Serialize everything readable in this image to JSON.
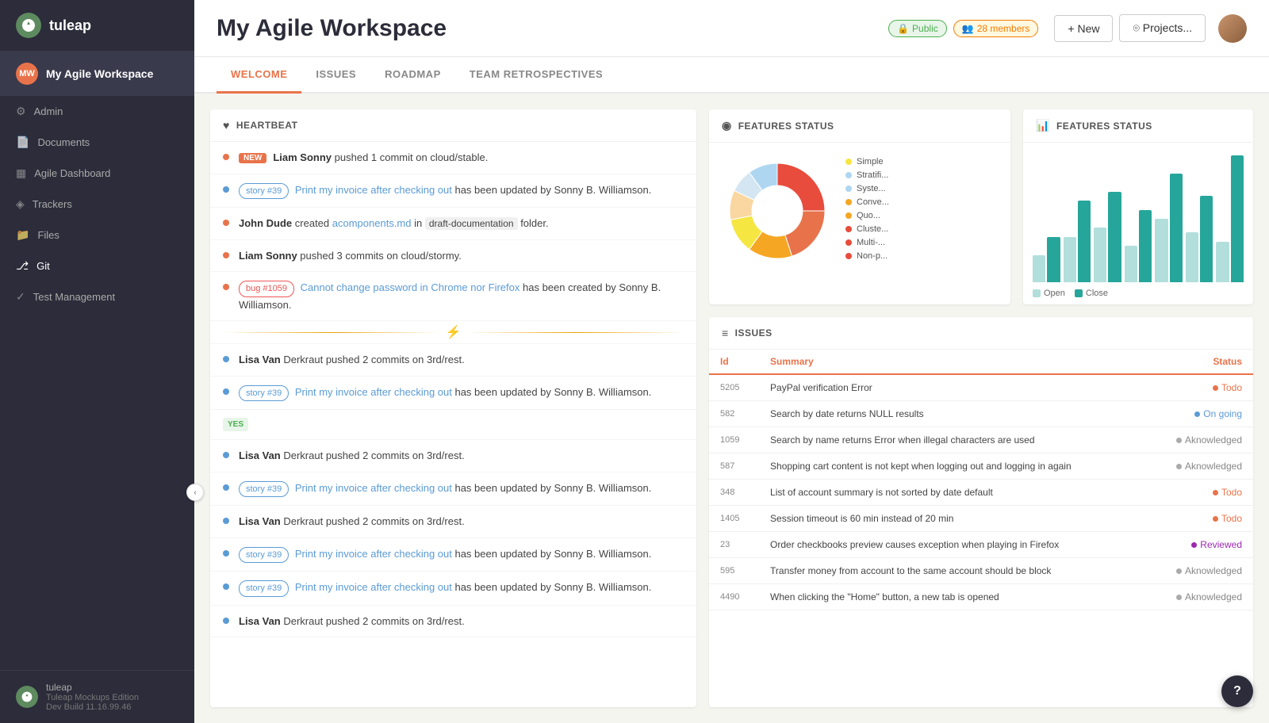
{
  "sidebar": {
    "logo": "tuleap",
    "workspace_name": "My Agile Workspace",
    "nav_items": [
      {
        "id": "admin",
        "label": "Admin",
        "icon": "⚙"
      },
      {
        "id": "documents",
        "label": "Documents",
        "icon": "📄"
      },
      {
        "id": "agile",
        "label": "Agile Dashboard",
        "icon": "⬜"
      },
      {
        "id": "trackers",
        "label": "Trackers",
        "icon": "◈"
      },
      {
        "id": "files",
        "label": "Files",
        "icon": "📁"
      },
      {
        "id": "git",
        "label": "Git",
        "icon": "⎇"
      },
      {
        "id": "test",
        "label": "Test Management",
        "icon": "✓"
      }
    ],
    "footer_app": "tuleap",
    "footer_edition": "Tuleap Mockups Edition",
    "footer_build": "Dev Build 11.16.99.46"
  },
  "header": {
    "title": "My Agile Workspace",
    "badge_public": "Public",
    "badge_members": "28 members",
    "btn_new": "+ New",
    "btn_projects": "⌾ Projects..."
  },
  "tabs": [
    {
      "id": "welcome",
      "label": "WELCOME",
      "active": true
    },
    {
      "id": "issues",
      "label": "ISSUES",
      "active": false
    },
    {
      "id": "roadmap",
      "label": "ROADMAP",
      "active": false
    },
    {
      "id": "retro",
      "label": "TEAM RETROSPECTIVES",
      "active": false
    }
  ],
  "heartbeat": {
    "title": "HEARTBEAT",
    "items": [
      {
        "type": "new_commit",
        "badge": "NEW",
        "text": "Liam Sonny pushed 1 commit on cloud/stable.",
        "dot": "orange"
      },
      {
        "type": "story",
        "story_num": "story #39",
        "text_before": "Print my invoice after checking out",
        "text_after": "has been updated by Sonny B. Williamson.",
        "dot": "blue"
      },
      {
        "type": "commit",
        "text": "John Dude created acomponents.md in draft-documentation folder.",
        "dot": "orange"
      },
      {
        "type": "commit",
        "text": "Liam Sonny pushed 3 commits on cloud/stormy.",
        "dot": "orange"
      },
      {
        "type": "bug",
        "bug_num": "bug #1059",
        "link_text": "Cannot change password in Chrome nor Firefox",
        "text_after": "has been created by Sonny B. Williamson.",
        "dot": "orange"
      },
      {
        "type": "divider"
      },
      {
        "type": "commit",
        "text": "Lisa Van Derkraut pushed 2 commits on 3rd/rest.",
        "dot": "blue"
      },
      {
        "type": "story",
        "story_num": "story #39",
        "text_before": "Print my invoice after checking out",
        "text_after": "has been updated by Sonny B. Williamson.",
        "dot": "blue"
      },
      {
        "type": "yes_divider"
      },
      {
        "type": "commit",
        "text": "Lisa Van Derkraut pushed 2 commits on 3rd/rest.",
        "dot": "blue"
      },
      {
        "type": "story",
        "story_num": "story #39",
        "text_before": "Print my invoice after checking out",
        "text_after": "has been updated by Sonny B. Williamson.",
        "dot": "blue"
      },
      {
        "type": "commit",
        "text": "Lisa Van Derkraut pushed 2 commits on 3rd/rest.",
        "dot": "blue"
      },
      {
        "type": "story",
        "story_num": "story #39",
        "text_before": "Print my invoice after checking out",
        "text_after": "has been updated by Sonny B. Williamson.",
        "dot": "blue"
      },
      {
        "type": "story",
        "story_num": "story #39",
        "text_before": "Print my invoice after checking out",
        "text_after": "has been updated by Sonny B. Williamson.",
        "dot": "blue"
      },
      {
        "type": "commit",
        "text": "Lisa Van Derkraut pushed 2 commits on 3rd/rest.",
        "dot": "blue"
      }
    ]
  },
  "features_donut": {
    "title": "FEATURES STATUS",
    "legend": [
      {
        "label": "Simple",
        "color": "#f5e642"
      },
      {
        "label": "Stratifi...",
        "color": "#aed6f1"
      },
      {
        "label": "Syste...",
        "color": "#aed6f1"
      },
      {
        "label": "Conve...",
        "color": "#f5a623"
      },
      {
        "label": "Quo...",
        "color": "#f5a623"
      },
      {
        "label": "Cluste...",
        "color": "#e74c3c"
      },
      {
        "label": "Multi-...",
        "color": "#e74c3c"
      },
      {
        "label": "Non-p...",
        "color": "#e74c3c"
      }
    ],
    "segments": [
      {
        "value": 25,
        "color": "#e74c3c"
      },
      {
        "value": 20,
        "color": "#e8734a"
      },
      {
        "value": 15,
        "color": "#f5a623"
      },
      {
        "value": 12,
        "color": "#f5e642"
      },
      {
        "value": 10,
        "color": "#fad7a0"
      },
      {
        "value": 8,
        "color": "#d4e6f1"
      },
      {
        "value": 10,
        "color": "#aed6f1"
      }
    ]
  },
  "features_bar": {
    "title": "FEATURES STATUS",
    "bars": [
      {
        "open": 30,
        "close": 50
      },
      {
        "open": 50,
        "close": 90
      },
      {
        "open": 60,
        "close": 100
      },
      {
        "open": 40,
        "close": 80
      },
      {
        "open": 70,
        "close": 120
      },
      {
        "open": 55,
        "close": 95
      },
      {
        "open": 45,
        "close": 140
      }
    ],
    "max": 140,
    "legend_open": "Open",
    "legend_close": "Close"
  },
  "issues": {
    "title": "ISSUES",
    "columns": [
      "Id",
      "Summary",
      "Status"
    ],
    "rows": [
      {
        "id": "5205",
        "summary": "PayPal verification Error",
        "status": "Todo",
        "status_type": "todo"
      },
      {
        "id": "582",
        "summary": "Search by date returns NULL results",
        "status": "On going",
        "status_type": "ongoing"
      },
      {
        "id": "1059",
        "summary": "Search by name returns Error when illegal characters are used",
        "status": "Aknowledged",
        "status_type": "ack"
      },
      {
        "id": "587",
        "summary": "Shopping cart content is not kept when logging out and logging in again",
        "status": "Aknowledged",
        "status_type": "ack"
      },
      {
        "id": "348",
        "summary": "List of account summary is not sorted by date default",
        "status": "Todo",
        "status_type": "todo"
      },
      {
        "id": "1405",
        "summary": "Session timeout is 60 min instead of 20 min",
        "status": "Todo",
        "status_type": "todo"
      },
      {
        "id": "23",
        "summary": "Order checkbooks preview causes exception when playing in Firefox",
        "status": "Reviewed",
        "status_type": "reviewed"
      },
      {
        "id": "595",
        "summary": "Transfer money from account to the same account should be block",
        "status": "Aknowledged",
        "status_type": "ack"
      },
      {
        "id": "4490",
        "summary": "When clicking the \"Home\" button, a new tab is opened",
        "status": "Aknowledged",
        "status_type": "ack"
      }
    ]
  }
}
